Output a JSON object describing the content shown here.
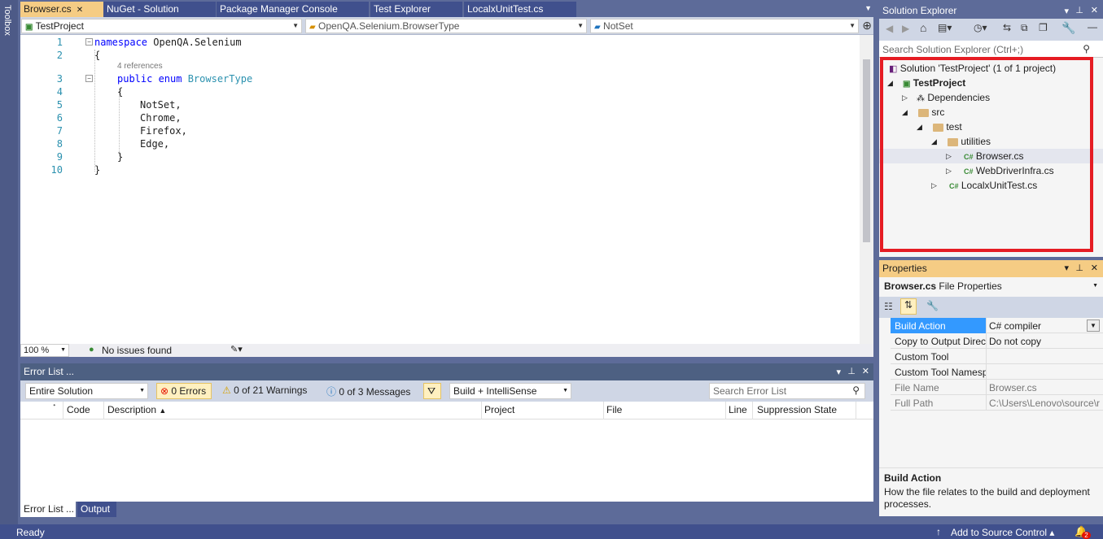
{
  "toolbox": {
    "label": "Toolbox"
  },
  "doc_tabs": [
    {
      "label": "Browser.cs",
      "active": true
    },
    {
      "label": "NuGet - Solution"
    },
    {
      "label": "Package Manager Console"
    },
    {
      "label": "Test Explorer"
    },
    {
      "label": "LocalxUnitTest.cs"
    }
  ],
  "navbar": {
    "project": "TestProject",
    "type": "OpenQA.Selenium.BrowserType",
    "member": "NotSet"
  },
  "editor": {
    "line_numbers": [
      "1",
      "2",
      "3",
      "4",
      "5",
      "6",
      "7",
      "8",
      "9",
      "10"
    ],
    "references": "4 references",
    "lines": {
      "l1_kw": "namespace",
      "l1_rest": " OpenQA.Selenium",
      "l2": "{",
      "l3_kw": "public enum",
      "l3_type": " BrowserType",
      "l4": "{",
      "l5": "NotSet,",
      "l6": "Chrome,",
      "l7": "Firefox,",
      "l8": "Edge,",
      "l9": "}",
      "l10": "}"
    },
    "zoom": "100 %",
    "issues": "No issues found"
  },
  "error_list": {
    "title": "Error List ...",
    "scope": "Entire Solution",
    "errors": "0 Errors",
    "warnings": "0 of 21 Warnings",
    "messages": "0 of 3 Messages",
    "build_filter": "Build + IntelliSense",
    "search_placeholder": "Search Error List",
    "columns": [
      "Code",
      "Description",
      "Project",
      "File",
      "Line",
      "Suppression State"
    ]
  },
  "bottom_tabs": [
    {
      "label": "Error List ..."
    },
    {
      "label": "Output"
    }
  ],
  "solution_explorer": {
    "title": "Solution Explorer",
    "search_placeholder": "Search Solution Explorer (Ctrl+;)",
    "tree": {
      "solution": "Solution 'TestProject' (1 of 1 project)",
      "project": "TestProject",
      "dependencies": "Dependencies",
      "src": "src",
      "test": "test",
      "utilities": "utilities",
      "browser": "Browser.cs",
      "webdriver": "WebDriverInfra.cs",
      "localx": "LocalxUnitTest.cs"
    },
    "cs_badge": "C#"
  },
  "properties": {
    "title": "Properties",
    "object_name": "Browser.cs",
    "object_type": "File Properties",
    "rows": [
      {
        "name": "Build Action",
        "value": "C# compiler"
      },
      {
        "name": "Copy to Output Directory",
        "value": "Do not copy"
      },
      {
        "name": "Custom Tool",
        "value": ""
      },
      {
        "name": "Custom Tool Namespace",
        "value": ""
      },
      {
        "name": "File Name",
        "value": "Browser.cs"
      },
      {
        "name": "Full Path",
        "value": "C:\\Users\\Lenovo\\source\\r"
      }
    ],
    "desc_title": "Build Action",
    "desc_text": "How the file relates to the build and deployment processes."
  },
  "statusbar": {
    "ready": "Ready",
    "source_control": "Add to Source Control",
    "notifications": "2"
  },
  "colors": {
    "accent_tab": "#f5cc84",
    "highlight_border": "#e51c23",
    "selected_row": "#3399ff"
  }
}
